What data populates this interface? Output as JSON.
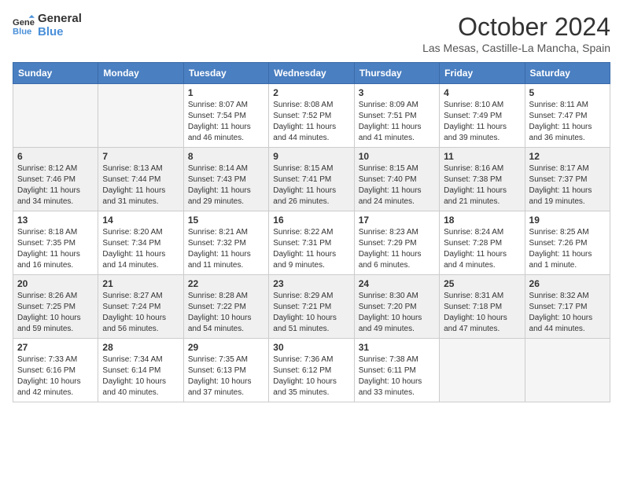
{
  "header": {
    "logo_line1": "General",
    "logo_line2": "Blue",
    "title": "October 2024",
    "location": "Las Mesas, Castille-La Mancha, Spain"
  },
  "weekdays": [
    "Sunday",
    "Monday",
    "Tuesday",
    "Wednesday",
    "Thursday",
    "Friday",
    "Saturday"
  ],
  "weeks": [
    [
      {
        "day": "",
        "empty": true
      },
      {
        "day": "",
        "empty": true
      },
      {
        "day": "1",
        "sunrise": "8:07 AM",
        "sunset": "7:54 PM",
        "daylight": "11 hours and 46 minutes."
      },
      {
        "day": "2",
        "sunrise": "8:08 AM",
        "sunset": "7:52 PM",
        "daylight": "11 hours and 44 minutes."
      },
      {
        "day": "3",
        "sunrise": "8:09 AM",
        "sunset": "7:51 PM",
        "daylight": "11 hours and 41 minutes."
      },
      {
        "day": "4",
        "sunrise": "8:10 AM",
        "sunset": "7:49 PM",
        "daylight": "11 hours and 39 minutes."
      },
      {
        "day": "5",
        "sunrise": "8:11 AM",
        "sunset": "7:47 PM",
        "daylight": "11 hours and 36 minutes."
      }
    ],
    [
      {
        "day": "6",
        "sunrise": "8:12 AM",
        "sunset": "7:46 PM",
        "daylight": "11 hours and 34 minutes."
      },
      {
        "day": "7",
        "sunrise": "8:13 AM",
        "sunset": "7:44 PM",
        "daylight": "11 hours and 31 minutes."
      },
      {
        "day": "8",
        "sunrise": "8:14 AM",
        "sunset": "7:43 PM",
        "daylight": "11 hours and 29 minutes."
      },
      {
        "day": "9",
        "sunrise": "8:15 AM",
        "sunset": "7:41 PM",
        "daylight": "11 hours and 26 minutes."
      },
      {
        "day": "10",
        "sunrise": "8:15 AM",
        "sunset": "7:40 PM",
        "daylight": "11 hours and 24 minutes."
      },
      {
        "day": "11",
        "sunrise": "8:16 AM",
        "sunset": "7:38 PM",
        "daylight": "11 hours and 21 minutes."
      },
      {
        "day": "12",
        "sunrise": "8:17 AM",
        "sunset": "7:37 PM",
        "daylight": "11 hours and 19 minutes."
      }
    ],
    [
      {
        "day": "13",
        "sunrise": "8:18 AM",
        "sunset": "7:35 PM",
        "daylight": "11 hours and 16 minutes."
      },
      {
        "day": "14",
        "sunrise": "8:20 AM",
        "sunset": "7:34 PM",
        "daylight": "11 hours and 14 minutes."
      },
      {
        "day": "15",
        "sunrise": "8:21 AM",
        "sunset": "7:32 PM",
        "daylight": "11 hours and 11 minutes."
      },
      {
        "day": "16",
        "sunrise": "8:22 AM",
        "sunset": "7:31 PM",
        "daylight": "11 hours and 9 minutes."
      },
      {
        "day": "17",
        "sunrise": "8:23 AM",
        "sunset": "7:29 PM",
        "daylight": "11 hours and 6 minutes."
      },
      {
        "day": "18",
        "sunrise": "8:24 AM",
        "sunset": "7:28 PM",
        "daylight": "11 hours and 4 minutes."
      },
      {
        "day": "19",
        "sunrise": "8:25 AM",
        "sunset": "7:26 PM",
        "daylight": "11 hours and 1 minute."
      }
    ],
    [
      {
        "day": "20",
        "sunrise": "8:26 AM",
        "sunset": "7:25 PM",
        "daylight": "10 hours and 59 minutes."
      },
      {
        "day": "21",
        "sunrise": "8:27 AM",
        "sunset": "7:24 PM",
        "daylight": "10 hours and 56 minutes."
      },
      {
        "day": "22",
        "sunrise": "8:28 AM",
        "sunset": "7:22 PM",
        "daylight": "10 hours and 54 minutes."
      },
      {
        "day": "23",
        "sunrise": "8:29 AM",
        "sunset": "7:21 PM",
        "daylight": "10 hours and 51 minutes."
      },
      {
        "day": "24",
        "sunrise": "8:30 AM",
        "sunset": "7:20 PM",
        "daylight": "10 hours and 49 minutes."
      },
      {
        "day": "25",
        "sunrise": "8:31 AM",
        "sunset": "7:18 PM",
        "daylight": "10 hours and 47 minutes."
      },
      {
        "day": "26",
        "sunrise": "8:32 AM",
        "sunset": "7:17 PM",
        "daylight": "10 hours and 44 minutes."
      }
    ],
    [
      {
        "day": "27",
        "sunrise": "7:33 AM",
        "sunset": "6:16 PM",
        "daylight": "10 hours and 42 minutes."
      },
      {
        "day": "28",
        "sunrise": "7:34 AM",
        "sunset": "6:14 PM",
        "daylight": "10 hours and 40 minutes."
      },
      {
        "day": "29",
        "sunrise": "7:35 AM",
        "sunset": "6:13 PM",
        "daylight": "10 hours and 37 minutes."
      },
      {
        "day": "30",
        "sunrise": "7:36 AM",
        "sunset": "6:12 PM",
        "daylight": "10 hours and 35 minutes."
      },
      {
        "day": "31",
        "sunrise": "7:38 AM",
        "sunset": "6:11 PM",
        "daylight": "10 hours and 33 minutes."
      },
      {
        "day": "",
        "empty": true
      },
      {
        "day": "",
        "empty": true
      }
    ]
  ]
}
